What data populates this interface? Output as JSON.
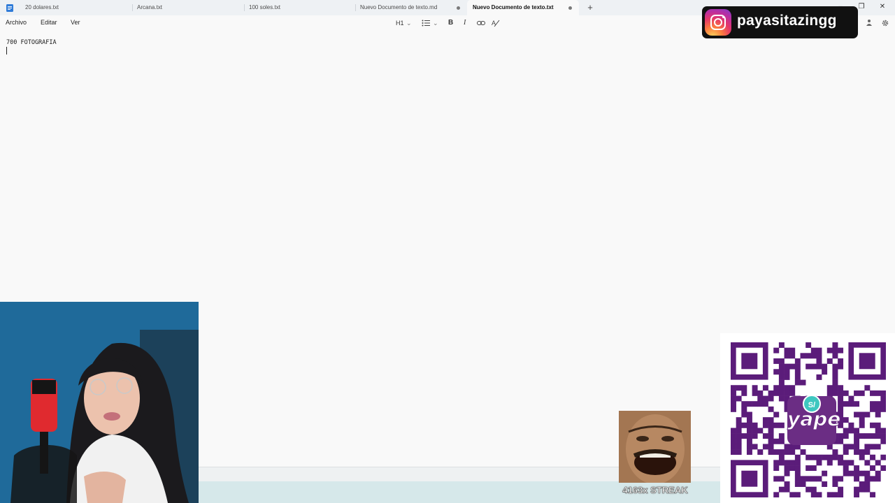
{
  "tabs": [
    {
      "label": "20 dolares.txt",
      "unsaved": false,
      "active": false
    },
    {
      "label": "Arcana.txt",
      "unsaved": false,
      "active": false
    },
    {
      "label": "100 soles.txt",
      "unsaved": false,
      "active": false
    },
    {
      "label": "Nuevo Documento de texto.md",
      "unsaved": true,
      "active": false
    },
    {
      "label": "Nuevo Documento de texto.txt",
      "unsaved": true,
      "active": true
    }
  ],
  "new_tab": "+",
  "window_controls": {
    "minimize": "–",
    "maximize": "❐",
    "close": "✕"
  },
  "menu": {
    "file": "Archivo",
    "edit": "Editar",
    "view": "Ver"
  },
  "toolbar": {
    "heading": "H1",
    "heading_chevron": "⌄",
    "list_chevron": "⌄",
    "bold": "B",
    "italic": "I"
  },
  "document": {
    "line1": "700 FOTOGRAFIA",
    "line2": ""
  },
  "overlay": {
    "instagram_handle": "payasitazingg",
    "streak": "4163x STREAK",
    "qr_brand": "yape",
    "qr_currency": "S/"
  },
  "colors": {
    "accent_qr": "#5b1c7a",
    "ig_bg": "#111111",
    "tab_strip": "#eef1f4"
  }
}
